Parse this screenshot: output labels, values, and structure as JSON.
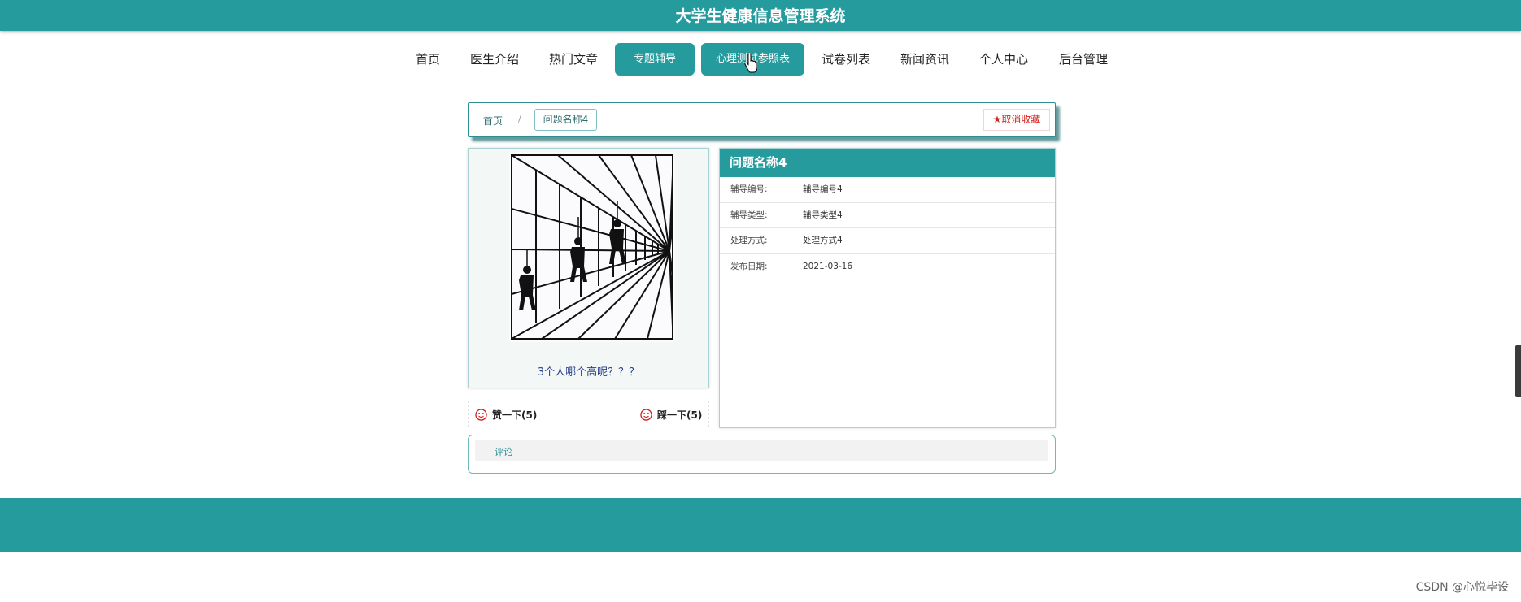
{
  "header": {
    "title": "大学生健康信息管理系统"
  },
  "nav": {
    "items": [
      {
        "label": "首页"
      },
      {
        "label": "医生介绍"
      },
      {
        "label": "热门文章"
      },
      {
        "label": "专题辅导",
        "active": true
      },
      {
        "label": "心理测试参照表",
        "active": true
      },
      {
        "label": "试卷列表"
      },
      {
        "label": "新闻资讯"
      },
      {
        "label": "个人中心"
      },
      {
        "label": "后台管理"
      }
    ]
  },
  "breadcrumb": {
    "home": "首页",
    "separator": "/",
    "current": "问题名称4"
  },
  "favorite": {
    "icon": "star-icon",
    "label": "取消收藏"
  },
  "image_panel": {
    "caption": "3个人哪个高呢？？？"
  },
  "votes": {
    "like": {
      "icon": "smile-face-icon",
      "label": "赞一下(5)"
    },
    "dislike": {
      "icon": "smile-face-icon",
      "label": "踩一下(5)"
    }
  },
  "detail": {
    "title": "问题名称4",
    "rows": [
      {
        "key": "辅导编号:",
        "value": "辅导编号4"
      },
      {
        "key": "辅导类型:",
        "value": "辅导类型4"
      },
      {
        "key": "处理方式:",
        "value": "处理方式4"
      },
      {
        "key": "发布日期:",
        "value": "2021-03-16"
      }
    ]
  },
  "comments": {
    "tab_label": "评论"
  },
  "watermark": "CSDN @心悦毕设",
  "colors": {
    "primary": "#259b9d",
    "favorite": "#d42020",
    "caption": "#2a3f8a"
  }
}
